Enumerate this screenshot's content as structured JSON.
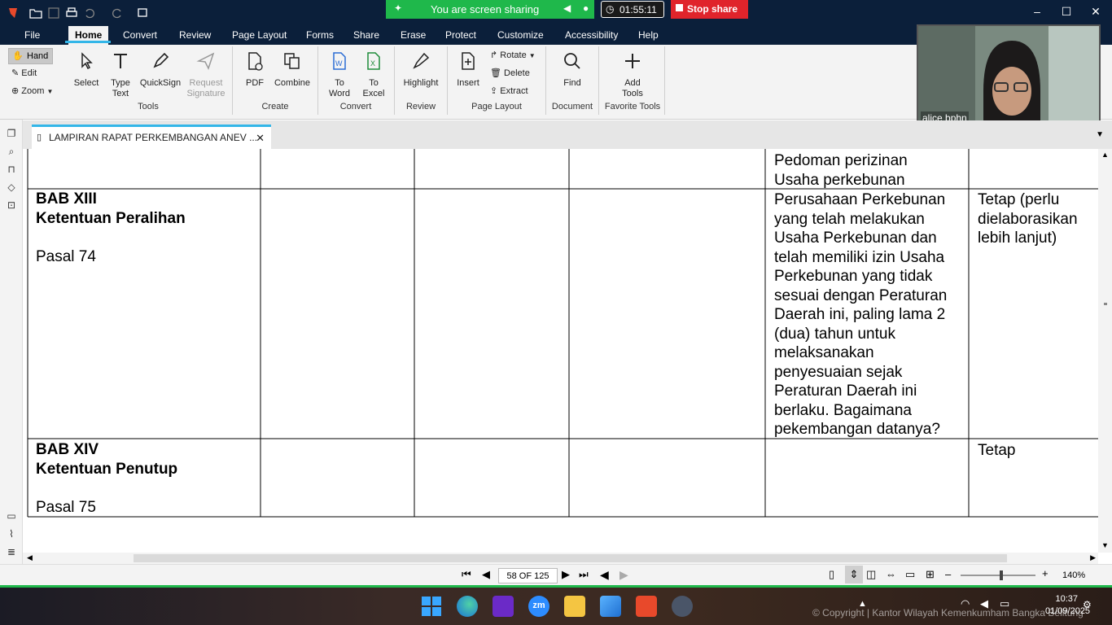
{
  "meeting": {
    "sharing_text": "You are screen sharing",
    "timer": "01:55:11",
    "stop_share": "Stop share",
    "participant_name": "alice bphn"
  },
  "menu": {
    "items": [
      "File",
      "Home",
      "Convert",
      "Review",
      "Page Layout",
      "Forms",
      "Share",
      "Erase",
      "Protect",
      "Customize",
      "Accessibility",
      "Help"
    ]
  },
  "ribbon": {
    "hand": "Hand",
    "edit": "Edit",
    "zoom": "Zoom",
    "select": "Select",
    "type_text_1": "Type",
    "type_text_2": "Text",
    "quicksign": "QuickSign",
    "request_sig_1": "Request",
    "request_sig_2": "Signature",
    "group_tools": "Tools",
    "pdf": "PDF",
    "combine": "Combine",
    "group_create": "Create",
    "to_word_1": "To",
    "to_word_2": "Word",
    "to_excel_1": "To",
    "to_excel_2": "Excel",
    "group_convert": "Convert",
    "highlight": "Highlight",
    "group_review": "Review",
    "insert": "Insert",
    "rotate": "Rotate",
    "delete": "Delete",
    "extract": "Extract",
    "group_page_layout": "Page Layout",
    "find": "Find",
    "group_document": "Document",
    "add_tools_1": "Add",
    "add_tools_2": "Tools",
    "group_favorite": "Favorite Tools"
  },
  "tab": {
    "title": "LAMPIRAN RAPAT PERKEMBANGAN ANEV ..."
  },
  "document": {
    "row0_col5": "Pedoman perizinan\nUsaha perkebunan",
    "row1_col1_title": "BAB XIII\nKetentuan Peralihan",
    "row1_col1_pasal": "Pasal 74",
    "row1_col5": "Perusahaan Perkebunan\nyang telah melakukan\nUsaha Perkebunan dan\ntelah memiliki izin Usaha\nPerkebunan yang tidak\nsesuai dengan Peraturan\nDaerah ini, paling lama 2\n(dua) tahun untuk\nmelaksanakan\npenyesuaian sejak\nPeraturan Daerah ini\nberlaku.  Bagaimana\npekembangan datanya?",
    "row1_col6": "Tetap (perlu\ndielaborasikan\nlebih lanjut)",
    "row2_col1_title": "BAB XIV\nKetentuan Penutup",
    "row2_col1_pasal": "Pasal 75",
    "row2_col6": "Tetap"
  },
  "status": {
    "page": "58 OF 125",
    "zoom": "140%"
  },
  "taskbar": {
    "time": "10:37",
    "date": "01/09/2025",
    "watermark": "© Copyright | Kantor Wilayah Kemenkumham Bangka Belitung"
  }
}
